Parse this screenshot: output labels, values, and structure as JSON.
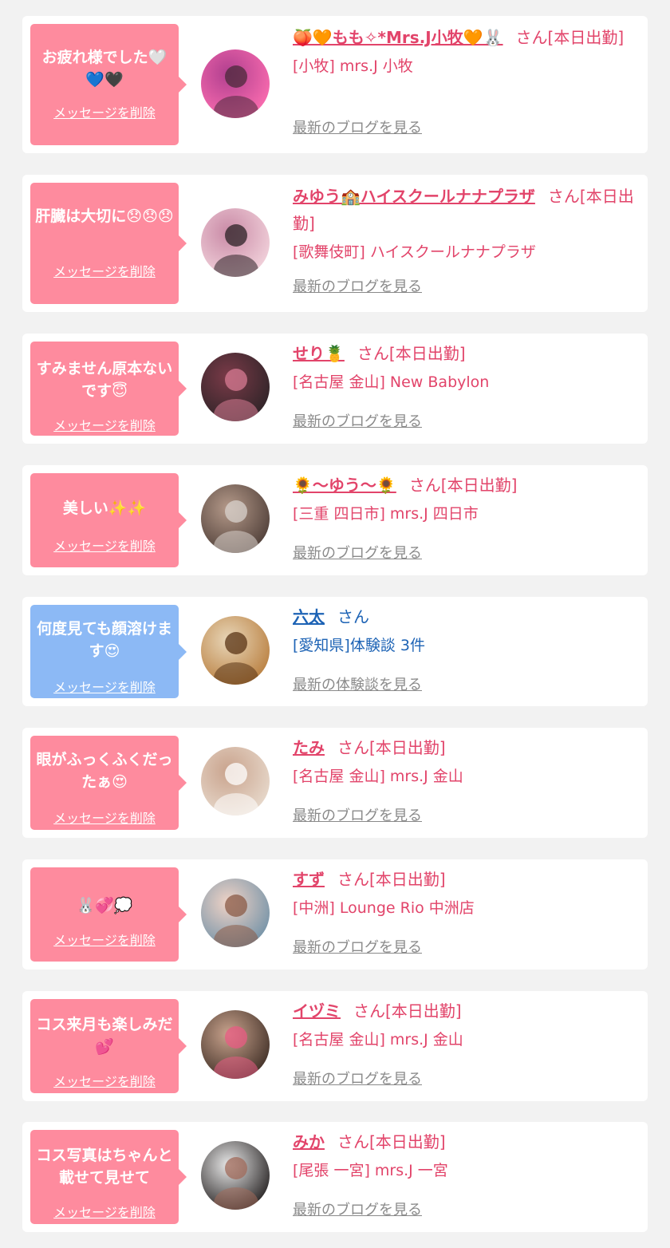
{
  "colors": {
    "background": "#f2f2f2",
    "card": "#ffffff",
    "bubble_pink": "#fe8b9e",
    "bubble_blue": "#8cb9f5",
    "name_pink": "#e2446a",
    "name_blue": "#1d63b5",
    "link_gray": "#8a8a8a"
  },
  "delete_label": "メッセージを削除",
  "items": [
    {
      "message": "お疲れ様でした🤍💙🖤",
      "bubble": "pink",
      "name": "🍑🧡もも✧*Mrs.J小牧🧡🐰",
      "suffix": "さん[本日出勤]",
      "shop": "[小牧] mrs.J 小牧",
      "link": "最新のブログを見る",
      "avatar_icon": "profile-photo"
    },
    {
      "message": "肝臓は大切に😞😞😞",
      "bubble": "pink",
      "name": "みゆう🏫ハイスクールナナプラザ",
      "suffix": "さん[本日出勤]",
      "shop": "[歌舞伎町] ハイスクールナナプラザ",
      "link": "最新のブログを見る",
      "avatar_icon": "profile-photo"
    },
    {
      "message": "すみません原本ないです😇",
      "bubble": "pink",
      "name": "せり🍍",
      "suffix": "さん[本日出勤]",
      "shop": "[名古屋 金山] New Babylon",
      "link": "最新のブログを見る",
      "avatar_icon": "profile-photo"
    },
    {
      "message": "美しい✨✨",
      "bubble": "pink",
      "name": "🌻〜ゆう〜🌻",
      "suffix": "さん[本日出勤]",
      "shop": "[三重 四日市] mrs.J 四日市",
      "link": "最新のブログを見る",
      "avatar_icon": "profile-photo"
    },
    {
      "message": "何度見ても顔溶けます😍",
      "bubble": "blue",
      "name": "六太",
      "suffix": "さん",
      "shop": "[愛知県]体験談 3件",
      "link": "最新の体験談を見る",
      "avatar_icon": "food-photo"
    },
    {
      "message": "眼がふっくふくだったぁ😍",
      "bubble": "pink",
      "name": "たみ",
      "suffix": "さん[本日出勤]",
      "shop": "[名古屋 金山] mrs.J 金山",
      "link": "最新のブログを見る",
      "avatar_icon": "profile-photo"
    },
    {
      "message": "🐰💞💭",
      "bubble": "pink",
      "name": "すず",
      "suffix": "さん[本日出勤]",
      "shop": "[中洲] Lounge Rio 中洲店",
      "link": "最新のブログを見る",
      "avatar_icon": "profile-photo"
    },
    {
      "message": "コス来月も楽しみだ💕",
      "bubble": "pink",
      "name": "イヅミ",
      "suffix": "さん[本日出勤]",
      "shop": "[名古屋 金山] mrs.J 金山",
      "link": "最新のブログを見る",
      "avatar_icon": "profile-photo"
    },
    {
      "message": "コス写真はちゃんと載せて見せて",
      "bubble": "pink",
      "name": "みか",
      "suffix": "さん[本日出勤]",
      "shop": "[尾張 一宮] mrs.J 一宮",
      "link": "最新のブログを見る",
      "avatar_icon": "profile-photo"
    }
  ]
}
